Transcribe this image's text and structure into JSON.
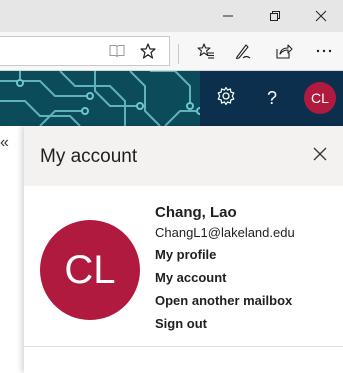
{
  "browser": {
    "window_controls": [
      "minimize-icon",
      "restore-icon",
      "close-icon"
    ],
    "toolbar_icons": [
      "reading-view-icon",
      "favorite-star-icon",
      "favorites-hub-icon",
      "pen-notes-icon",
      "share-icon",
      "more-icon"
    ]
  },
  "header": {
    "settings_icon": "gear-icon",
    "help_label": "?",
    "avatar_initials": "CL"
  },
  "sidebar": {
    "collapse_arrow": "«"
  },
  "account_panel": {
    "title": "My account",
    "close_icon": "close-icon",
    "avatar_initials": "CL",
    "user_name": "Chang, Lao",
    "user_email": "ChangL1@lakeland.edu",
    "links": {
      "my_profile": "My profile",
      "my_account": "My account",
      "open_another_mailbox": "Open another mailbox",
      "sign_out": "Sign out"
    }
  },
  "colors": {
    "avatar": "#b11a3f",
    "banner_teal": "#0c4b5a",
    "banner_navy": "#0b2f4d",
    "panel_header": "#f4f2f1"
  }
}
